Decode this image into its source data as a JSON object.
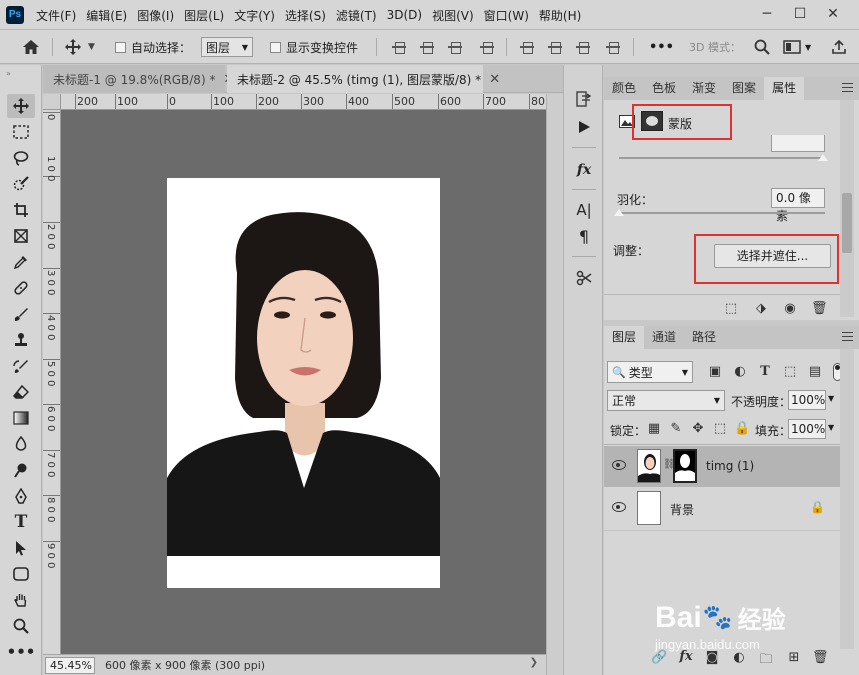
{
  "app": {
    "logo": "Ps"
  },
  "menu": [
    "文件(F)",
    "编辑(E)",
    "图像(I)",
    "图层(L)",
    "文字(Y)",
    "选择(S)",
    "滤镜(T)",
    "3D(D)",
    "视图(V)",
    "窗口(W)",
    "帮助(H)"
  ],
  "window_controls": {
    "minimize": "─",
    "maximize": "☐",
    "close": "✕"
  },
  "options": {
    "auto_select_label": "自动选择：",
    "auto_select_value": "图层",
    "show_transform_label": "显示变换控件",
    "more": "•••",
    "mode_3d": "3D 模式："
  },
  "tabs": [
    {
      "label": "未标题-1 @ 19.8%(RGB/8) *",
      "close": "✕"
    },
    {
      "label": "未标题-2 @ 45.5% (timg (1), 图层蒙版/8) *",
      "close": "✕"
    }
  ],
  "ruler_top": [
    "200",
    "100",
    "0",
    "100",
    "200",
    "300",
    "400",
    "500",
    "600",
    "700",
    "80"
  ],
  "ruler_left": [
    "0",
    "1\n0\n0",
    "2\n0\n0",
    "3\n0\n0",
    "4\n0\n0",
    "5\n0\n0",
    "6\n0\n0",
    "7\n0\n0",
    "8\n0\n0",
    "9\n0\n0"
  ],
  "status": {
    "zoom": "45.45%",
    "doc_info": "600 像素 x 900 像素 (300 ppi)",
    "arrow": "❯"
  },
  "tools": [
    "move",
    "marquee",
    "lasso",
    "quick-select",
    "crop",
    "frame",
    "eyedropper",
    "healing",
    "brush",
    "stamp",
    "history-brush",
    "eraser",
    "gradient",
    "blur",
    "dodge",
    "pen",
    "type",
    "path-select",
    "shape",
    "hand",
    "zoom",
    "more"
  ],
  "properties_panel": {
    "tabs": [
      "颜色",
      "色板",
      "渐变",
      "图案",
      "属性"
    ],
    "active_tab": "属性",
    "mask_label": "蒙版",
    "feather_label": "羽化：",
    "feather_value": "0.0 像素",
    "refine_label": "调整：",
    "select_and_mask_button": "选择并遮住..."
  },
  "layers_panel": {
    "tabs": [
      "图层",
      "通道",
      "路径"
    ],
    "active_tab": "图层",
    "filter_kind": "类型",
    "blend_mode": "正常",
    "opacity_label": "不透明度：",
    "opacity_value": "100%",
    "lock_label": "锁定：",
    "fill_label": "填充：",
    "fill_value": "100%",
    "layers": [
      {
        "name": "timg (1)",
        "selected": true,
        "has_mask": true
      },
      {
        "name": "背景",
        "selected": false,
        "locked": true
      }
    ]
  },
  "watermark": {
    "brand": "Bai",
    "brand2": "经验",
    "url": "jingyan.baidu.com"
  },
  "colors": {
    "accent_red": "#e03030",
    "canvas_bg": "#6b6b6b",
    "panel_bg": "#d6d6d6"
  }
}
